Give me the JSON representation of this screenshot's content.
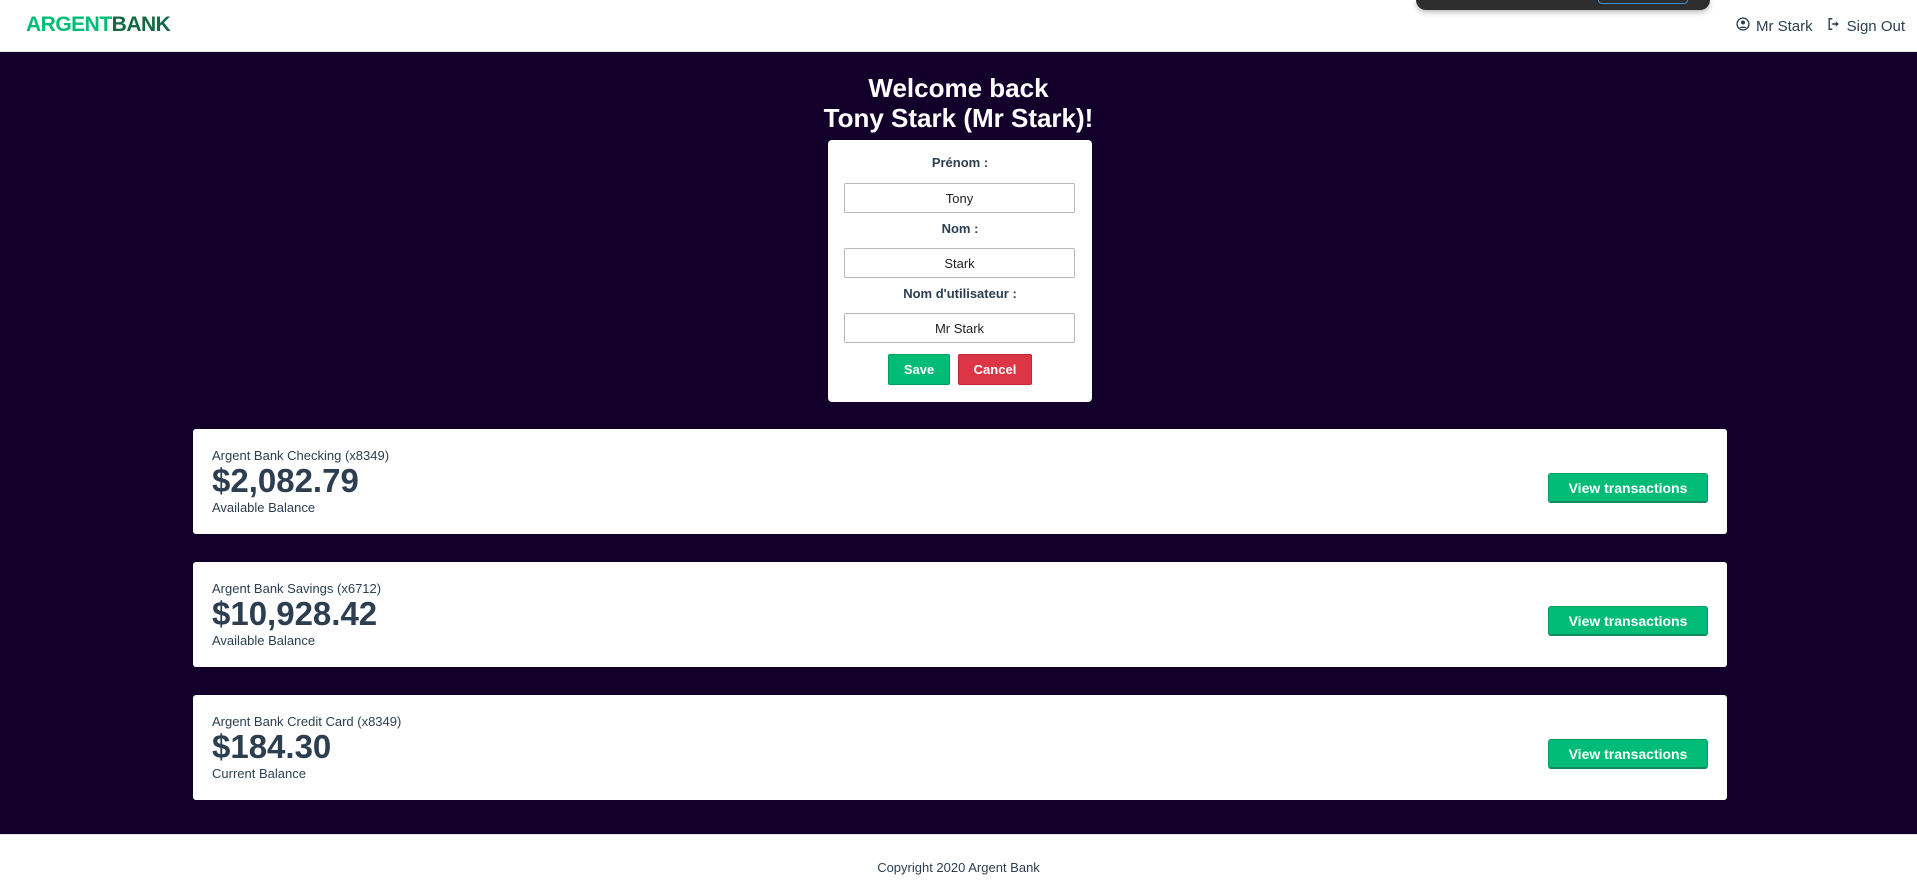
{
  "header": {
    "logo_part1": "ARGENT",
    "logo_part2": "BANK",
    "user_name": "Mr Stark",
    "sign_out": "Sign Out"
  },
  "welcome": {
    "line1": "Welcome back",
    "line2": "Tony Stark (Mr Stark)!"
  },
  "edit_form": {
    "first_name_label": "Prénom :",
    "first_name_value": "Tony",
    "last_name_label": "Nom :",
    "last_name_value": "Stark",
    "username_label": "Nom d'utilisateur :",
    "username_value": "Mr Stark",
    "save_label": "Save",
    "cancel_label": "Cancel"
  },
  "accounts": [
    {
      "title": "Argent Bank Checking (x8349)",
      "amount": "$2,082.79",
      "description": "Available Balance",
      "button": "View transactions"
    },
    {
      "title": "Argent Bank Savings (x6712)",
      "amount": "$10,928.42",
      "description": "Available Balance",
      "button": "View transactions"
    },
    {
      "title": "Argent Bank Credit Card (x8349)",
      "amount": "$184.30",
      "description": "Current Balance",
      "button": "View transactions"
    }
  ],
  "footer": {
    "copyright": "Copyright 2020 Argent Bank"
  },
  "colors": {
    "accent": "#00bc77",
    "main_background": "#12002b",
    "cancel": "#dc3545"
  },
  "icons": {
    "user": "user-circle-icon",
    "sign_out": "sign-out-icon"
  }
}
